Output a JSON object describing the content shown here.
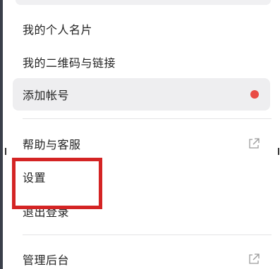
{
  "menu": {
    "items": [
      {
        "label": "我的个人名片"
      },
      {
        "label": "我的二维码与链接"
      },
      {
        "label": "添加帐号",
        "badge": "red-dot"
      },
      {
        "label": "帮助与客服",
        "icon": "external-link-icon"
      },
      {
        "label": "设置"
      },
      {
        "label": "退出登录"
      },
      {
        "label": "管理后台",
        "icon": "external-link-icon"
      }
    ]
  },
  "colors": {
    "highlight_bg": "#eeeef0",
    "badge_red": "#e94b45",
    "annotation_red": "#d42424"
  }
}
